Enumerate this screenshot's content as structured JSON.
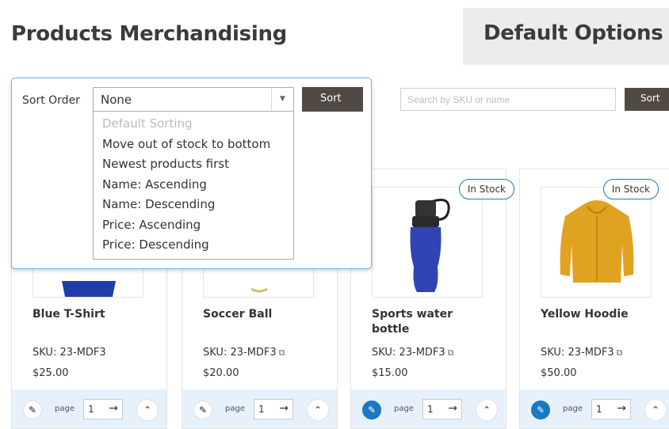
{
  "header": {
    "title": "Products Merchandising",
    "default_options_label": "Default Options"
  },
  "search": {
    "placeholder": "Search by SKU or name",
    "button_label": "Sort"
  },
  "sort_popup": {
    "label": "Sort Order",
    "selected": "None",
    "button_label": "Sort",
    "options": [
      "Default Sorting",
      "Move out of stock to bottom",
      "Newest products first",
      "Name: Ascending",
      "Name: Descending",
      "Price: Ascending",
      "Price: Descending"
    ]
  },
  "products": [
    {
      "name": "Blue T-Shirt",
      "sku": "SKU: 23-MDF3",
      "price": "$25.00",
      "badge": "",
      "page_label": "page",
      "page_value": "1"
    },
    {
      "name": "Soccer Ball",
      "sku": "SKU: 23-MDF3",
      "price": "$20.00",
      "badge": "",
      "page_label": "page",
      "page_value": "1"
    },
    {
      "name": "Sports water bottle",
      "sku": "SKU: 23-MDF3",
      "price": "$15.00",
      "badge": "In Stock",
      "page_label": "page",
      "page_value": "1"
    },
    {
      "name": "Yellow Hoodie",
      "sku": "SKU: 23-MDF3",
      "price": "$50.00",
      "badge": "In Stock",
      "page_label": "page",
      "page_value": "1"
    }
  ],
  "colors": {
    "accent": "#1979c3",
    "button_dark": "#514943",
    "footer_bg": "#e6f1fb"
  },
  "icons": {
    "pin": "pin-icon",
    "arrow": "arrow-right-icon",
    "up": "chevron-up-icon",
    "copy": "copy-icon",
    "caret": "caret-down-icon"
  }
}
